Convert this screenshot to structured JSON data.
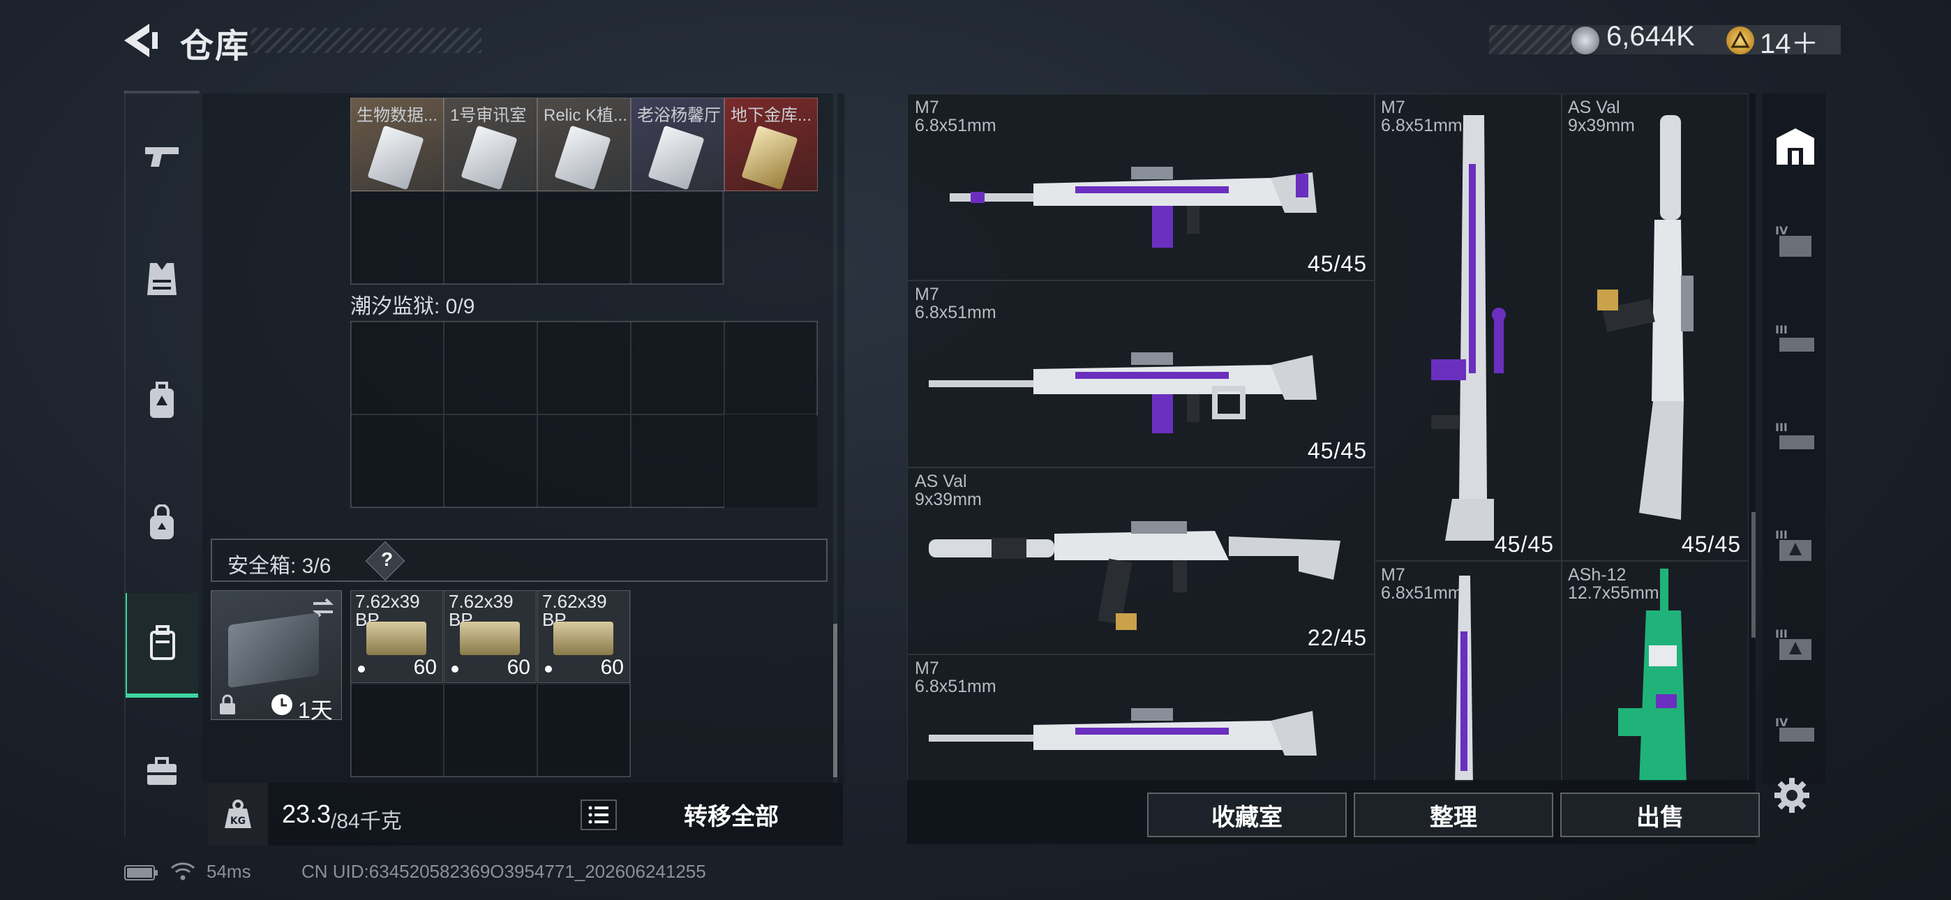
{
  "header": {
    "title": "仓库",
    "currency_silver": "6,644K",
    "currency_gold": "14＋"
  },
  "left_rail": {
    "items": [
      {
        "name": "pistol-icon"
      },
      {
        "name": "vest-icon"
      },
      {
        "name": "backpack-armor-icon"
      },
      {
        "name": "bag-icon"
      },
      {
        "name": "safebox-icon",
        "active": true
      },
      {
        "name": "toolbox-icon"
      }
    ]
  },
  "storage": {
    "keycards": [
      "生物数据...",
      "1号审讯室",
      "Relic K植...",
      "老浴杨馨厅",
      "地下金库..."
    ],
    "prison_label": "潮汐监狱: 0/9",
    "safebox_label": "安全箱: 3/6",
    "safebox_help": "?",
    "safebox_timer": "1天",
    "ammo": [
      {
        "name": "7.62x39 BP",
        "count": "60"
      },
      {
        "name": "7.62x39 BP",
        "count": "60"
      },
      {
        "name": "7.62x39 BP",
        "count": "60"
      }
    ]
  },
  "weight": {
    "value": "23.3",
    "max": "/84千克",
    "transfer_all": "转移全部"
  },
  "weapons": [
    {
      "name": "M7",
      "caliber": "6.8x51mm",
      "ammo": "45/45"
    },
    {
      "name": "M7",
      "caliber": "6.8x51mm",
      "ammo": "45/45"
    },
    {
      "name": "AS Val",
      "caliber": "9x39mm",
      "ammo": "22/45"
    },
    {
      "name": "M7",
      "caliber": "6.8x51mm",
      "ammo": ""
    },
    {
      "name": "M7",
      "caliber": "6.8x51mm",
      "ammo": "45/45"
    },
    {
      "name": "AS Val",
      "caliber": "9x39mm",
      "ammo": "45/45"
    },
    {
      "name": "M7",
      "caliber": "6.8x51mm",
      "ammo": ""
    },
    {
      "name": "ASh-12",
      "caliber": "12.7x55mm",
      "ammo": ""
    }
  ],
  "right_rail": {
    "tabs": [
      "IV",
      "III",
      "III",
      "III",
      "III",
      "IV"
    ]
  },
  "buttons": {
    "collection": "收藏室",
    "organize": "整理",
    "sell": "出售"
  },
  "status": {
    "ping": "54ms",
    "uid": "CN UID:634520582369O3954771_202606241255"
  },
  "colors": {
    "accent": "#3dd6a0",
    "weapon_purple": "#6b2fbf",
    "weapon_green": "#1fb37a"
  }
}
